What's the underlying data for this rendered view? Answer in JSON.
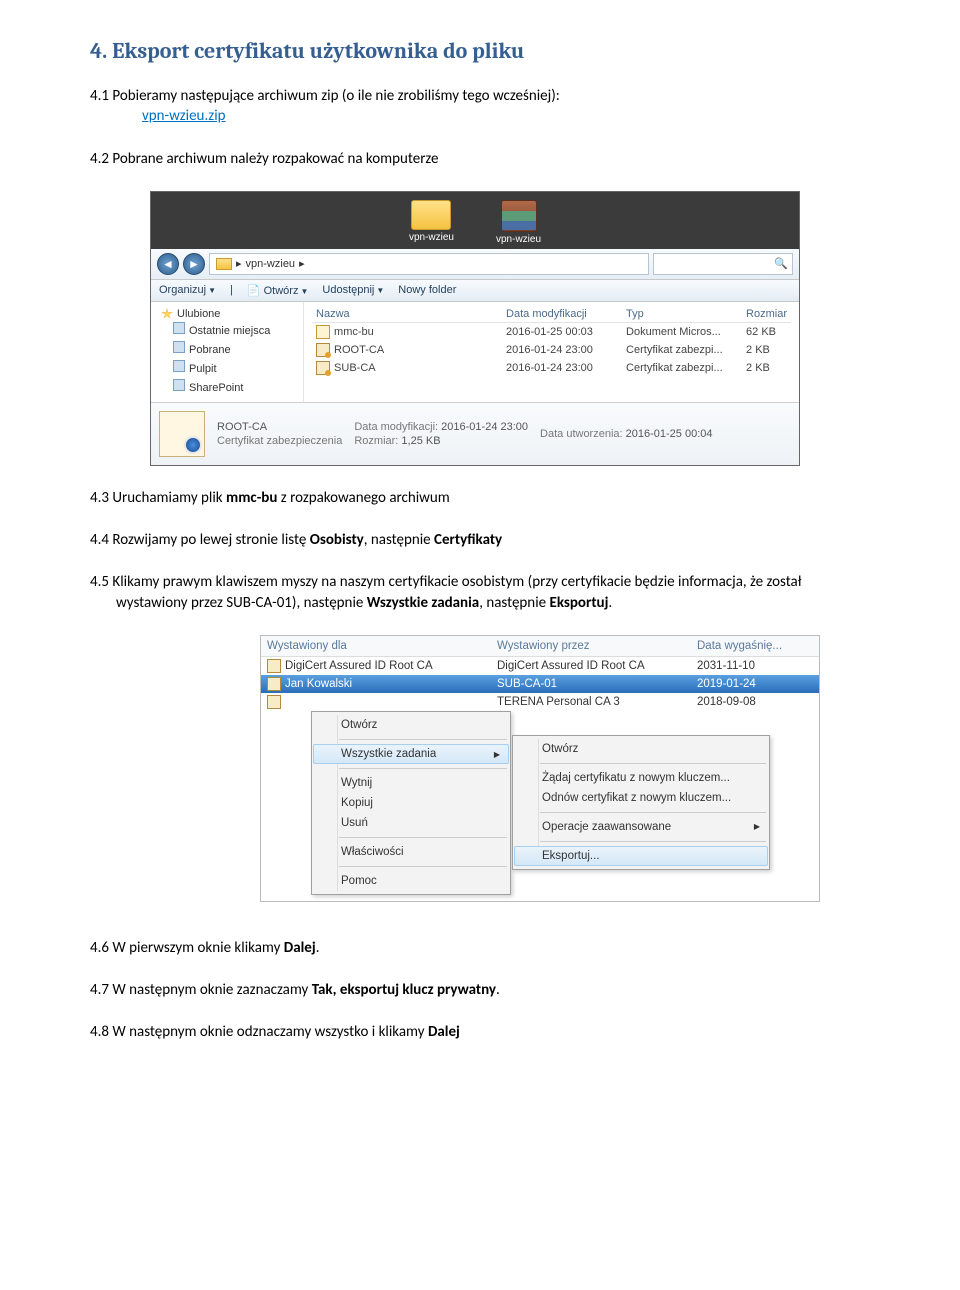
{
  "section": {
    "number": "4.",
    "title": "Eksport certyfikatu użytkownika do pliku"
  },
  "p41": {
    "num": "4.1",
    "text": "Pobieramy następujące archiwum zip (o ile nie zrobiliśmy tego wcześniej):",
    "link": "vpn-wzieu.zip"
  },
  "p42": {
    "num": "4.2",
    "text": "Pobrane archiwum należy rozpakować na komputerze"
  },
  "p43": {
    "num": "4.3",
    "before": "Uruchamiamy plik ",
    "bold": "mmc-bu",
    "after": " z rozpakowanego archiwum"
  },
  "p44": {
    "num": "4.4",
    "before": "Rozwijamy po lewej stronie listę ",
    "b1": "Osobisty",
    "mid": ", następnie ",
    "b2": "Certyfikaty"
  },
  "p45": {
    "num": "4.5",
    "part1": "Klikamy prawym klawiszem myszy na naszym certyfikacie osobistym (przy certyfikacie będzie informacja, że został wystawiony przez SUB-CA-01), następnie ",
    "b1": "Wszystkie zadania",
    "mid": ", następnie ",
    "b2": "Eksportuj",
    "tail": "."
  },
  "p46": {
    "num": "4.6",
    "before": "W pierwszym oknie klikamy ",
    "b1": "Dalej",
    "after": "."
  },
  "p47": {
    "num": "4.7",
    "before": "W następnym oknie zaznaczamy ",
    "b1": "Tak, eksportuj klucz prywatny",
    "after": "."
  },
  "p48": {
    "num": "4.8",
    "before": "W następnym oknie odznaczamy wszystko i klikamy ",
    "b1": "Dalej"
  },
  "explorer": {
    "desktop_items": [
      "vpn-wzieu",
      "vpn-wzieu"
    ],
    "addr_segments": [
      "▸",
      "vpn-wzieu",
      "▸"
    ],
    "toolbar": [
      "Organizuj",
      "Otwórz",
      "Udostępnij",
      "Nowy folder"
    ],
    "nav_head": "Ulubione",
    "nav_items": [
      "Ostatnie miejsca",
      "Pobrane",
      "Pulpit",
      "SharePoint"
    ],
    "columns": [
      "Nazwa",
      "Data modyfikacji",
      "Typ",
      "Rozmiar"
    ],
    "files": [
      {
        "name": "mmc-bu",
        "mod": "2016-01-25 00:03",
        "type": "Dokument Micros...",
        "size": "62 KB"
      },
      {
        "name": "ROOT-CA",
        "mod": "2016-01-24 23:00",
        "type": "Certyfikat zabezpi...",
        "size": "2 KB"
      },
      {
        "name": "SUB-CA",
        "mod": "2016-01-24 23:00",
        "type": "Certyfikat zabezpi...",
        "size": "2 KB"
      }
    ],
    "detail": {
      "name": "ROOT-CA",
      "type": "Certyfikat zabezpieczenia",
      "mod_label": "Data modyfikacji:",
      "mod": "2016-01-24 23:00",
      "created_label": "Data utworzenia:",
      "created": "2016-01-25 00:04",
      "size_label": "Rozmiar:",
      "size": "1,25 KB"
    }
  },
  "ctx": {
    "columns": [
      "Wystawiony dla",
      "Wystawiony przez",
      "Data wygaśnię..."
    ],
    "rows": [
      {
        "for": "DigiCert Assured ID Root CA",
        "by": "DigiCert Assured ID Root CA",
        "exp": "2031-11-10"
      },
      {
        "for": "Jan Kowalski",
        "by": "SUB-CA-01",
        "exp": "2019-01-24",
        "selected": true
      },
      {
        "for": "",
        "by": "TERENA Personal CA 3",
        "exp": "2018-09-08"
      }
    ],
    "menu1": {
      "items": [
        "Otwórz"
      ],
      "sub": "Wszystkie zadania",
      "group2": [
        "Wytnij",
        "Kopiuj",
        "Usuń"
      ],
      "group3": [
        "Właściwości"
      ],
      "group4": [
        "Pomoc"
      ]
    },
    "menu2": {
      "items": [
        "Otwórz"
      ],
      "group2": [
        "Żądaj certyfikatu z nowym kluczem...",
        "Odnów certyfikat z nowym kluczem..."
      ],
      "group3": [
        "Operacje zaawansowane"
      ],
      "export": "Eksportuj..."
    }
  }
}
